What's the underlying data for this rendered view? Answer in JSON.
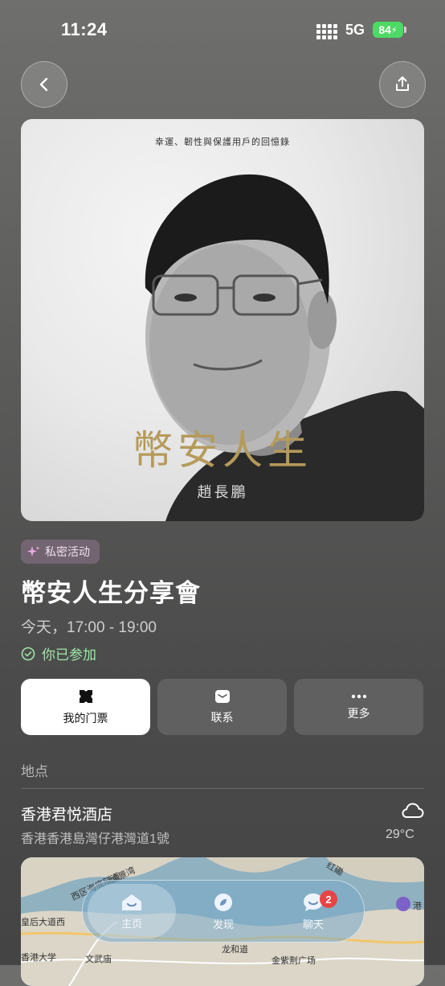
{
  "status_bar": {
    "time": "11:24",
    "network": "5G",
    "battery": "84"
  },
  "header": {
    "back_icon": "chevron-left-icon",
    "share_icon": "share-icon"
  },
  "cover": {
    "subtitle": "幸運、韌性與保護用戶的回憶錄",
    "title": "幣安人生",
    "author": "趙長鵬"
  },
  "event": {
    "badge": "私密活动",
    "title": "幣安人生分享會",
    "time": "今天，17:00 - 19:00",
    "status": "你已参加"
  },
  "actions": [
    {
      "label": "我的门票",
      "icon": "ticket-icon"
    },
    {
      "label": "联系",
      "icon": "message-icon"
    },
    {
      "label": "更多",
      "icon": "more-icon"
    }
  ],
  "location": {
    "section_label": "地点",
    "venue": "香港君悦酒店",
    "address": "香港香港島灣仔港灣道1號",
    "weather_icon": "cloud-icon",
    "temperature": "29°C"
  },
  "map": {
    "labels": [
      "西区海底隧道",
      "愉景湾",
      "红磡",
      "皇后大道西",
      "香港大学",
      "文武庙",
      "龙和道",
      "金紫荆广场",
      "港"
    ]
  },
  "tabbar": {
    "tabs": [
      {
        "label": "主页",
        "icon": "home-icon",
        "active": true
      },
      {
        "label": "发现",
        "icon": "discover-icon",
        "active": false
      },
      {
        "label": "聊天",
        "icon": "chat-icon",
        "active": false,
        "badge": "2"
      }
    ]
  },
  "colors": {
    "accent_green": "#9fe6a7",
    "gold": "#b59a5a",
    "badge_red": "#e64545"
  }
}
